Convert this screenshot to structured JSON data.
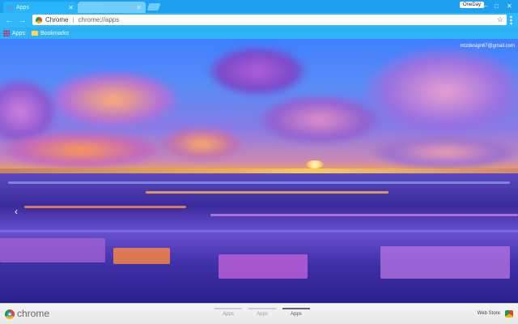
{
  "tabs": [
    {
      "label": "Apps",
      "active": true
    },
    {
      "label": "",
      "active": false
    }
  ],
  "profile_label": "OneDay",
  "window_controls": {
    "minimize": "–",
    "maximize": "□",
    "close": "✕"
  },
  "toolbar": {
    "back_glyph": "←",
    "forward_glyph": "→",
    "site_label": "Chrome",
    "separator": "|",
    "url": "chrome://apps",
    "star_glyph": "☆"
  },
  "bookmarks": [
    {
      "label": "Apps",
      "icon": "apps-grid-icon"
    },
    {
      "label": "Bookmarks",
      "icon": "folder-icon"
    }
  ],
  "account_email": "mtzdesign67@gmail.com",
  "prev_glyph": "‹",
  "bottom": {
    "brand": "chrome",
    "pages": [
      {
        "label": "Apps",
        "active": false
      },
      {
        "label": "Apps",
        "active": false
      },
      {
        "label": "Apps",
        "active": true
      }
    ],
    "webstore_label": "Web Store"
  },
  "colors": {
    "tab_strip": "#1e9ff0",
    "toolbar": "#30b8fb",
    "bottom_bar": "#f0f0f0"
  }
}
